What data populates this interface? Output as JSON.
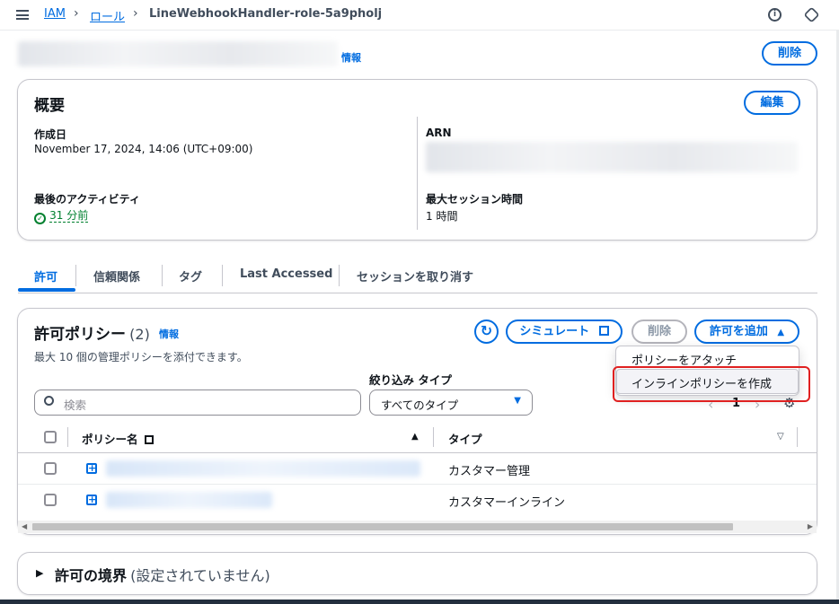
{
  "breadcrumb": {
    "root": "IAM",
    "roles": "ロール",
    "current": "LineWebhookHandler-role-5a9pholj"
  },
  "header": {
    "info": "情報",
    "delete_label": "削除"
  },
  "summary": {
    "title": "概要",
    "edit_label": "編集",
    "created_label": "作成日",
    "created_value": "November 17, 2024, 14:06 (UTC+09:00)",
    "arn_label": "ARN",
    "last_activity_label": "最後のアクティビティ",
    "last_activity_value": "31 分前",
    "max_session_label": "最大セッション時間",
    "max_session_value": "1 時間"
  },
  "tabs": [
    "許可",
    "信頼関係",
    "タグ",
    "Last Accessed",
    "セッションを取り消す"
  ],
  "policies": {
    "title": "許可ポリシー",
    "count": "(2)",
    "info": "情報",
    "description": "最大 10 個の管理ポリシーを添付できます。",
    "simulate_label": "シミュレート",
    "delete_label": "削除",
    "add_label": "許可を追加",
    "filter_type_label": "絞り込み タイプ",
    "filter_type_value": "すべてのタイプ",
    "search_placeholder": "検索",
    "page_number": "1",
    "columns": {
      "name": "ポリシー名",
      "type": "タイプ"
    },
    "rows": [
      {
        "type": "カスタマー管理"
      },
      {
        "type": "カスタマーインライン"
      }
    ]
  },
  "add_menu": {
    "attach": "ポリシーをアタッチ",
    "create_inline": "インラインポリシーを作成"
  },
  "boundary": {
    "title": "許可の境界",
    "status": "(設定されていません)"
  }
}
